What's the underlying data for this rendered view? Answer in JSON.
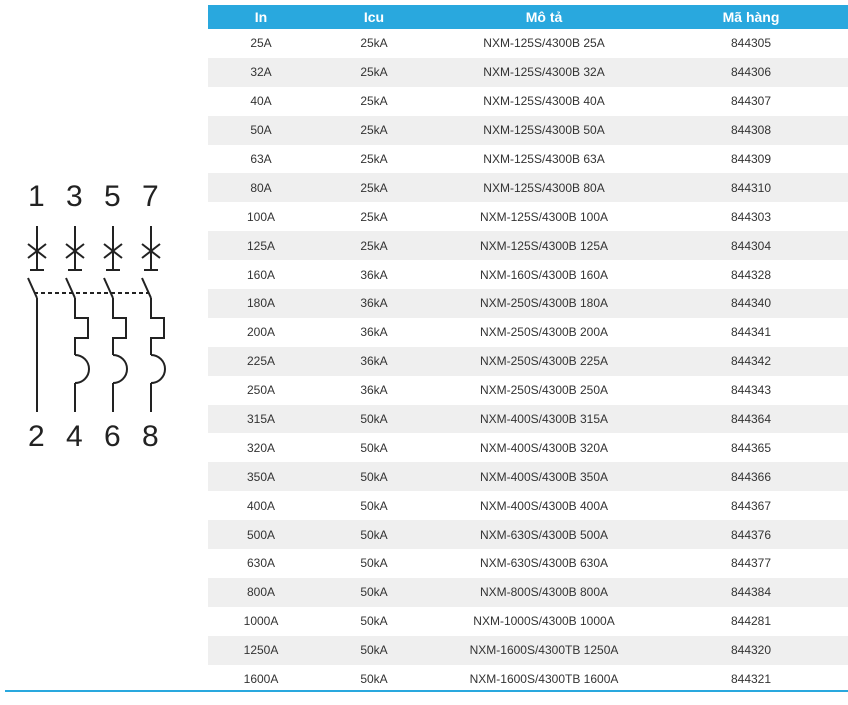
{
  "table": {
    "headers": [
      "In",
      "Icu",
      "Mô tả",
      "Mã hàng"
    ],
    "rows": [
      [
        "25A",
        "25kA",
        "NXM-125S/4300B 25A",
        "844305"
      ],
      [
        "32A",
        "25kA",
        "NXM-125S/4300B 32A",
        "844306"
      ],
      [
        "40A",
        "25kA",
        "NXM-125S/4300B 40A",
        "844307"
      ],
      [
        "50A",
        "25kA",
        "NXM-125S/4300B 50A",
        "844308"
      ],
      [
        "63A",
        "25kA",
        "NXM-125S/4300B 63A",
        "844309"
      ],
      [
        "80A",
        "25kA",
        "NXM-125S/4300B 80A",
        "844310"
      ],
      [
        "100A",
        "25kA",
        "NXM-125S/4300B 100A",
        "844303"
      ],
      [
        "125A",
        "25kA",
        "NXM-125S/4300B 125A",
        "844304"
      ],
      [
        "160A",
        "36kA",
        "NXM-160S/4300B 160A",
        "844328"
      ],
      [
        "180A",
        "36kA",
        "NXM-250S/4300B 180A",
        "844340"
      ],
      [
        "200A",
        "36kA",
        "NXM-250S/4300B 200A",
        "844341"
      ],
      [
        "225A",
        "36kA",
        "NXM-250S/4300B 225A",
        "844342"
      ],
      [
        "250A",
        "36kA",
        "NXM-250S/4300B 250A",
        "844343"
      ],
      [
        "315A",
        "50kA",
        "NXM-400S/4300B 315A",
        "844364"
      ],
      [
        "320A",
        "50kA",
        "NXM-400S/4300B 320A",
        "844365"
      ],
      [
        "350A",
        "50kA",
        "NXM-400S/4300B 350A",
        "844366"
      ],
      [
        "400A",
        "50kA",
        "NXM-400S/4300B 400A",
        "844367"
      ],
      [
        "500A",
        "50kA",
        "NXM-630S/4300B 500A",
        "844376"
      ],
      [
        "630A",
        "50kA",
        "NXM-630S/4300B 630A",
        "844377"
      ],
      [
        "800A",
        "50kA",
        "NXM-800S/4300B 800A",
        "844384"
      ],
      [
        "1000A",
        "50kA",
        "NXM-1000S/4300B 1000A",
        "844281"
      ],
      [
        "1250A",
        "50kA",
        "NXM-1600S/4300TB 1250A",
        "844320"
      ],
      [
        "1600A",
        "50kA",
        "NXM-1600S/4300TB 1600A",
        "844321"
      ]
    ]
  },
  "diagram": {
    "top_terminals": [
      "1",
      "3",
      "5",
      "7"
    ],
    "bottom_terminals": [
      "2",
      "4",
      "6",
      "8"
    ]
  },
  "colors": {
    "header": "#29a8de",
    "stripe": "#efefef",
    "rule": "#29a8de"
  }
}
